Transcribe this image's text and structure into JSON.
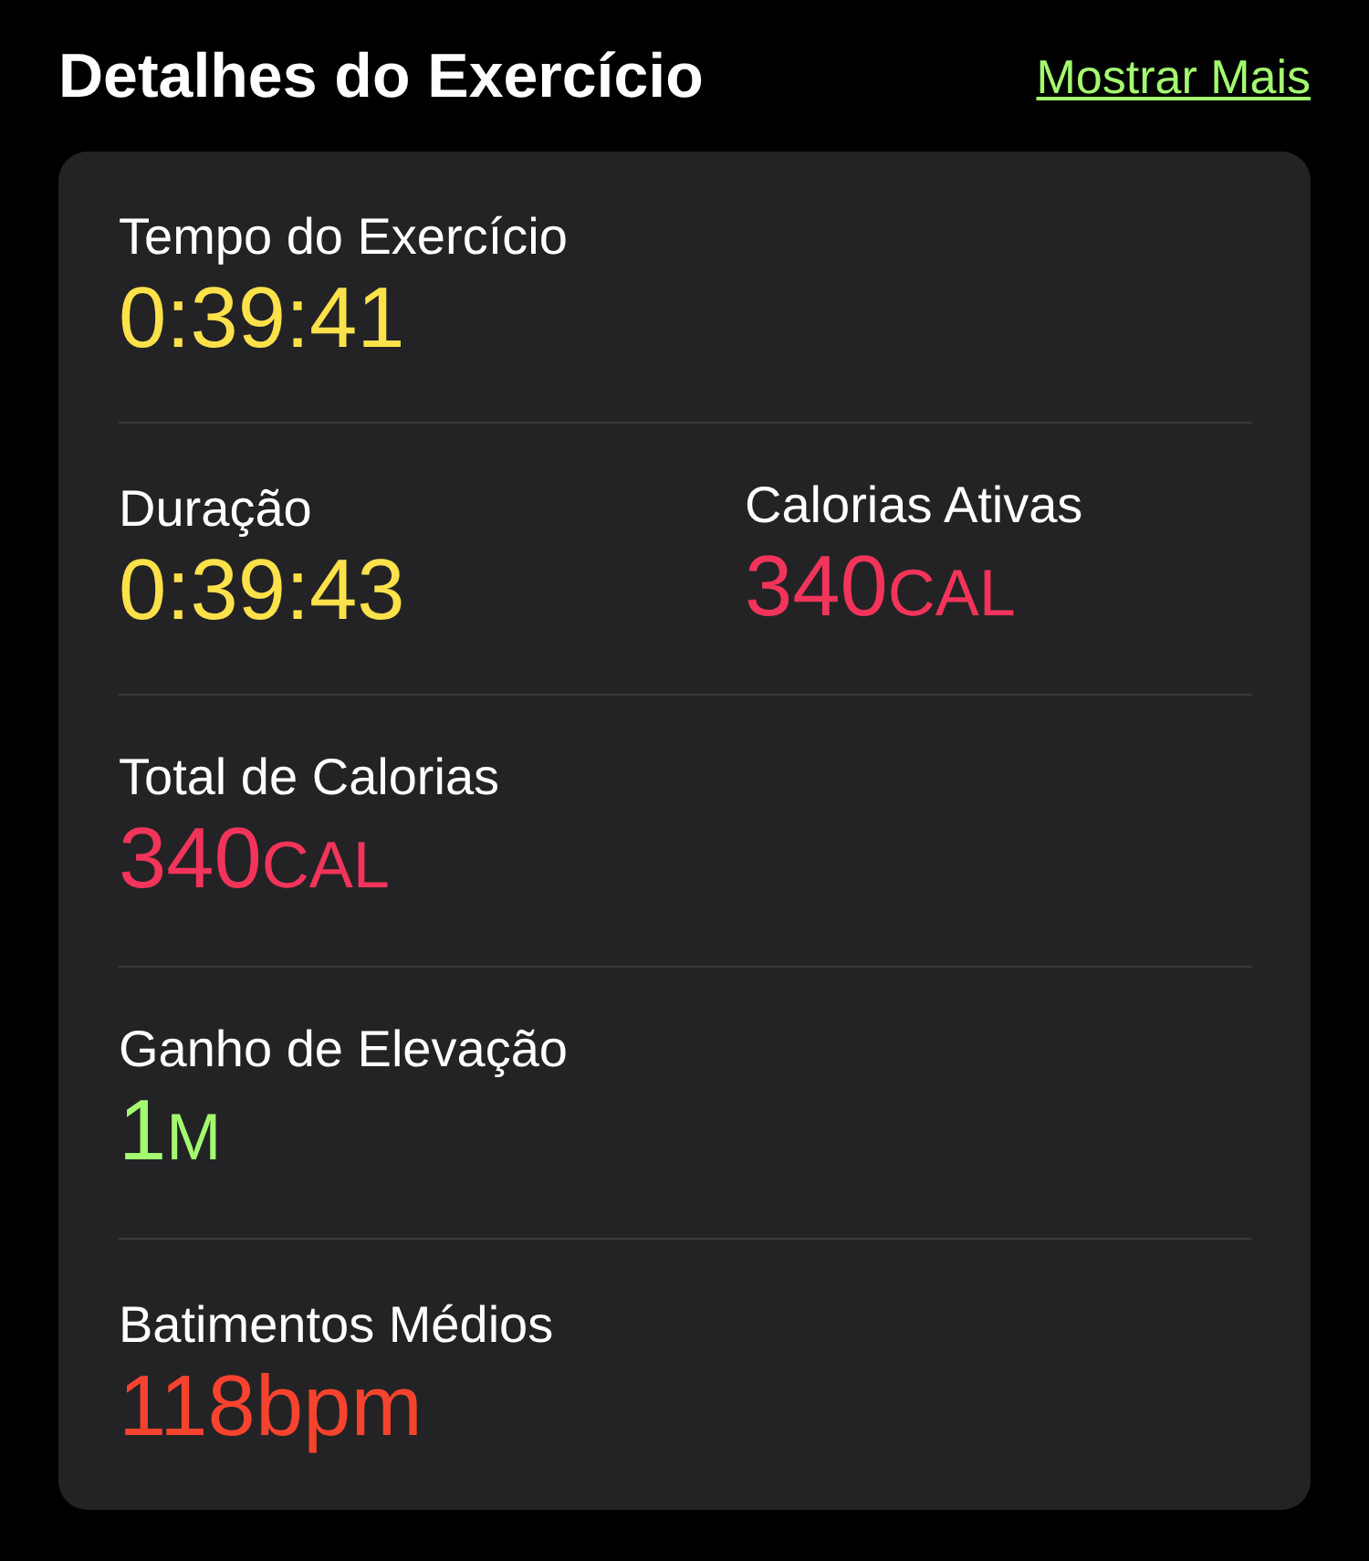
{
  "header": {
    "title": "Detalhes do Exercício",
    "link": "Mostrar Mais"
  },
  "rows": [
    {
      "metrics": [
        {
          "label": "Tempo do Exercício",
          "value": "0:39:41",
          "color": "#fce14a"
        }
      ]
    },
    {
      "metrics": [
        {
          "label": "Duração",
          "value": "0:39:43",
          "color": "#fce14a"
        },
        {
          "label": "Calorias Ativas",
          "value": "340",
          "unit": "CAL",
          "color": "#f2345a"
        }
      ]
    },
    {
      "metrics": [
        {
          "label": "Total de Calorias",
          "value": "340",
          "unit": "CAL",
          "color": "#f2345a"
        }
      ]
    },
    {
      "metrics": [
        {
          "label": "Ganho de Elevação",
          "value": "1",
          "unit": "M",
          "color": "#a3fa70"
        }
      ]
    },
    {
      "metrics": [
        {
          "label": "Batimentos Médios",
          "value": "118",
          "unit": "bpm",
          "color": "#f6432e"
        }
      ]
    }
  ]
}
